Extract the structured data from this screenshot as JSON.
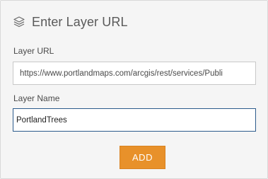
{
  "dialog": {
    "title": "Enter Layer URL",
    "icon": "layers-icon"
  },
  "fields": {
    "layer_url": {
      "label": "Layer URL",
      "value": "https://www.portlandmaps.com/arcgis/rest/services/Publi"
    },
    "layer_name": {
      "label": "Layer Name",
      "value": "PortlandTrees"
    }
  },
  "actions": {
    "add_label": "ADD"
  },
  "colors": {
    "accent": "#e8912a",
    "focus_border": "#2c5b8c",
    "panel_background": "#f5f5f5"
  }
}
